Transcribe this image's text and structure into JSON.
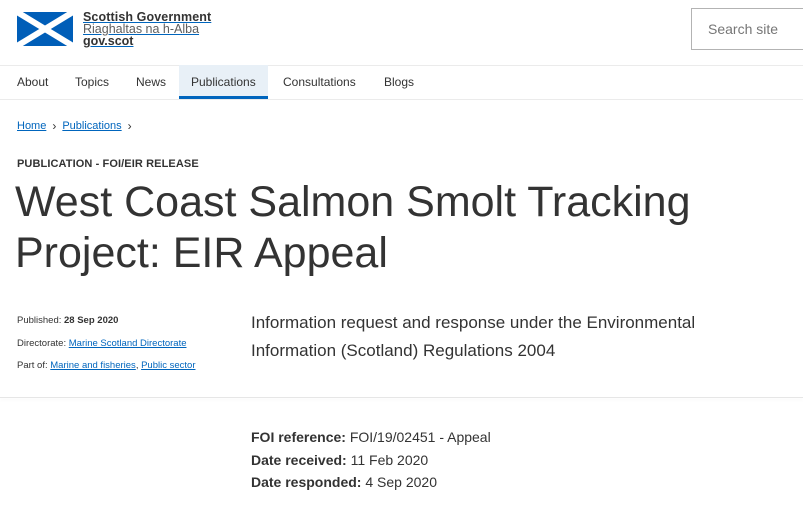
{
  "brand": {
    "line1": "Scottish Government",
    "line2": "Riaghaltas na h-Alba",
    "line3": "gov.scot",
    "flag_blue": "#005eb8",
    "flag_white": "#ffffff"
  },
  "search": {
    "placeholder": "Search site"
  },
  "nav": {
    "items": [
      {
        "label": "About"
      },
      {
        "label": "Topics"
      },
      {
        "label": "News"
      },
      {
        "label": "Publications",
        "active": true
      },
      {
        "label": "Consultations"
      },
      {
        "label": "Blogs"
      }
    ]
  },
  "breadcrumb": {
    "items": [
      {
        "label": "Home"
      },
      {
        "label": "Publications"
      }
    ],
    "separator": "›"
  },
  "publication": {
    "type_label": "PUBLICATION - FOI/EIR RELEASE",
    "title": "West Coast Salmon Smolt Tracking Project: EIR Appeal",
    "published_label": "Published:",
    "published_value": "28 Sep 2020",
    "directorate_label": "Directorate:",
    "directorate_value": "Marine Scotland Directorate",
    "partof_label": "Part of:",
    "partof_links": [
      "Marine and fisheries",
      "Public sector"
    ],
    "partof_sep": ",",
    "lead": "Information request and response under the Environmental Information (Scotland) Regulations 2004"
  },
  "foi": {
    "reference_label": "FOI reference:",
    "reference_value": "FOI/19/02451 - Appeal",
    "received_label": "Date received:",
    "received_value": "11 Feb 2020",
    "responded_label": "Date responded:",
    "responded_value": "4 Sep 2020"
  },
  "colors": {
    "link": "#0065bd",
    "text": "#333333",
    "nav_active_bg": "#e8f0f7"
  }
}
